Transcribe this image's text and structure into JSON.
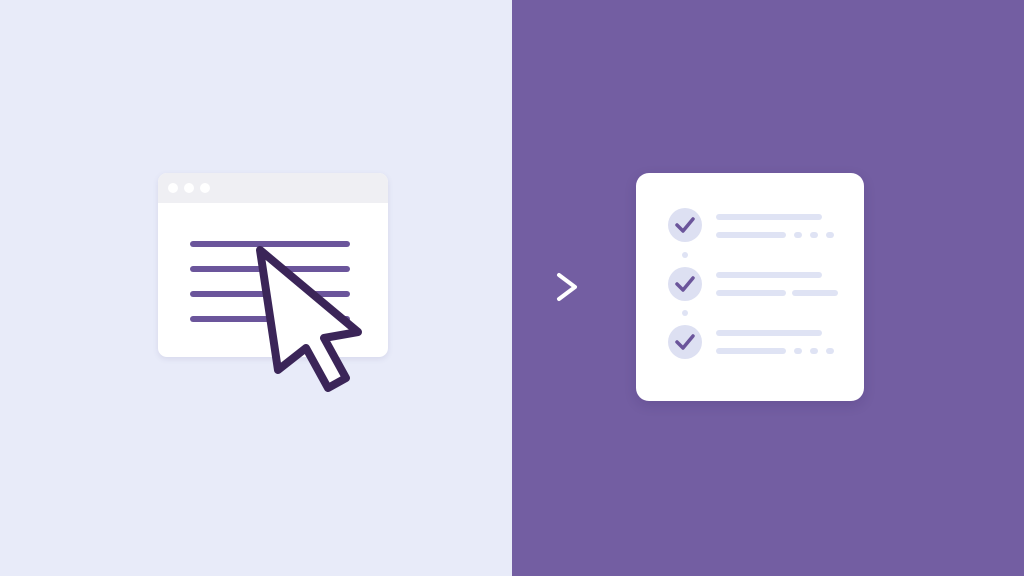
{
  "colors": {
    "left_background": "#e8ebf9",
    "right_background": "#735ea2",
    "accent": "#6b559b",
    "cursor_outline": "#3b2558",
    "card": "#ffffff",
    "placeholder_line": "#dfe3f4",
    "check_circle": "#dde0f2"
  },
  "illustration": {
    "left": {
      "browser_window": {
        "title_bar_dots": 3,
        "content_lines": 4
      },
      "pointer": "mouse-cursor-icon"
    },
    "transition": "right-arrow-icon",
    "right": {
      "checklist": {
        "items": [
          {
            "checked": true
          },
          {
            "checked": true
          },
          {
            "checked": true
          }
        ]
      }
    }
  }
}
